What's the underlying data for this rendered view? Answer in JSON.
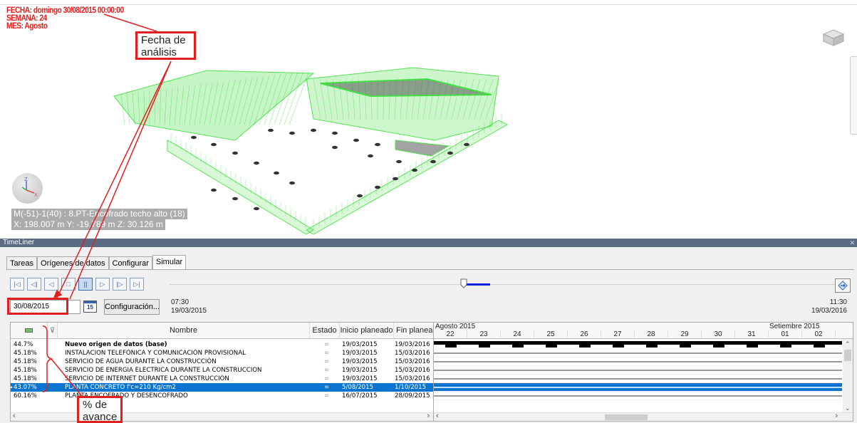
{
  "hud": {
    "fecha": "FECHA: domingo 30/08/2015 00:00:00",
    "semana": "SEMANA:  24",
    "mes": "MES: Agosto"
  },
  "viewport": {
    "element_info": "M(-51)-1(40) : 8.PT-Encofrado techo alto (18)",
    "coordinates": "X: 198.007 m  Y: -19.789 m  Z: 30.126 m",
    "model_color": "#33dd33"
  },
  "annotations": {
    "date_callout_line1": "Fecha de",
    "date_callout_line2": "análisis",
    "progress_callout_line1": "% de",
    "progress_callout_line2": "avance",
    "color": "#e02020"
  },
  "timeliner": {
    "title": "TimeLiner",
    "tabs": [
      "Tareas",
      "Orígenes de datos",
      "Configurar",
      "Simular"
    ],
    "active_tab": "Simular",
    "date_value": "30/08/2015",
    "calendar_day": "15",
    "config_button": "Configuración...",
    "start_time": "07:30",
    "start_date": "19/03/2015",
    "end_time": "11:30",
    "end_date": "19/03/2016",
    "slider_position": 0.44,
    "transport_buttons": [
      "go-start-icon",
      "step-back-icon",
      "play-reverse-icon",
      "stop-icon",
      "pause-icon",
      "play-icon",
      "step-forward-icon",
      "go-end-icon"
    ]
  },
  "grid": {
    "columns": {
      "nombre": "Nombre",
      "estado": "Estado",
      "inicio": "Inicio planeado",
      "fin": "Fin planeado"
    },
    "rows": [
      {
        "pct": "44.7%",
        "nombre": "Nuevo origen de datos (base)",
        "estado": "=",
        "inicio": "19/03/2015",
        "fin": "19/03/2016",
        "bold": true,
        "selected": false
      },
      {
        "pct": "45.18%",
        "nombre": "INSTALACION TELEFÓNICA Y COMUNICACIÓN PROVISIONAL",
        "estado": "=",
        "inicio": "19/03/2015",
        "fin": "15/03/2016",
        "bold": false,
        "selected": false
      },
      {
        "pct": "45.18%",
        "nombre": "SERVICIO DE AGUA DURANTE LA CONSTRUCCIÓN",
        "estado": "=",
        "inicio": "19/03/2015",
        "fin": "15/03/2016",
        "bold": false,
        "selected": false
      },
      {
        "pct": "45.18%",
        "nombre": "SERVICIO DE ENERGIA ELECTRICA DURANTE LA CONSTRUCCION",
        "estado": "=",
        "inicio": "19/03/2015",
        "fin": "15/03/2016",
        "bold": false,
        "selected": false
      },
      {
        "pct": "45.18%",
        "nombre": "SERVICIO DE INTERNET DURANTE LA CONSTRUCCIÓN",
        "estado": "=",
        "inicio": "19/03/2015",
        "fin": "15/03/2016",
        "bold": false,
        "selected": false
      },
      {
        "pct": "43.07%",
        "nombre": "PLANTA CONCRETO f'c=210 Kg/cm2",
        "estado": "=",
        "inicio": "5/08/2015",
        "fin": "1/10/2015",
        "bold": false,
        "selected": true
      },
      {
        "pct": "60.16%",
        "nombre": "PLANTA ENCOFRADO Y DESENCOFRADO",
        "estado": "=",
        "inicio": "16/07/2015",
        "fin": "28/09/2015",
        "bold": false,
        "selected": false
      }
    ]
  },
  "gantt": {
    "months": [
      "Agosto 2015",
      "Setiembre 2015"
    ],
    "days": [
      "22",
      "23",
      "24",
      "25",
      "26",
      "27",
      "28",
      "29",
      "30",
      "31",
      "01",
      "02"
    ],
    "selected_color": "#0a75d1"
  }
}
